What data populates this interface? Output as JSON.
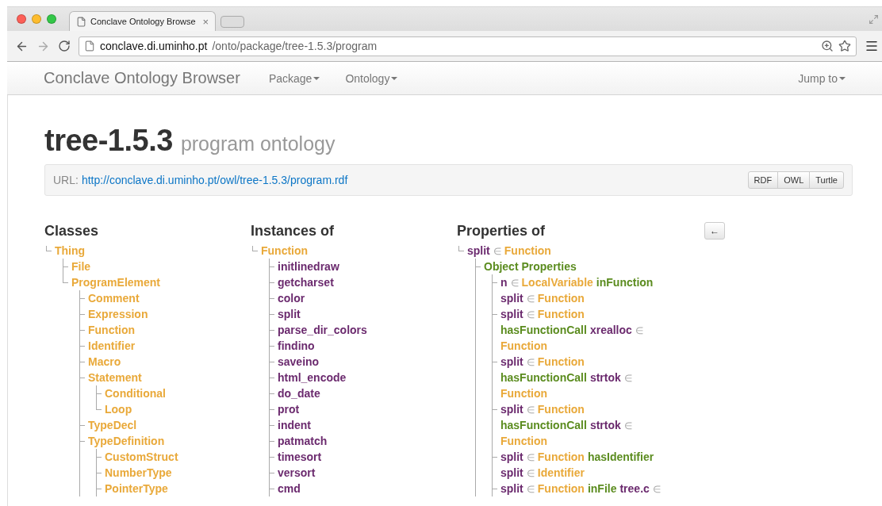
{
  "browser": {
    "tab": {
      "title": "Conclave Ontology Browse",
      "close": "×"
    },
    "address": {
      "host": "conclave.di.uminho.pt",
      "path": "/onto/package/tree-1.5.3/program"
    }
  },
  "navbar": {
    "brand": "Conclave Ontology Browser",
    "menus": [
      {
        "label": "Package"
      },
      {
        "label": "Ontology"
      }
    ],
    "right_menu": {
      "label": "Jump to"
    }
  },
  "header": {
    "title": "tree-1.5.3",
    "subtitle": "program ontology"
  },
  "url_bar": {
    "label": "URL:",
    "link": "http://conclave.di.uminho.pt/owl/tree-1.5.3/program.rdf",
    "formats": [
      "RDF",
      "OWL",
      "Turtle"
    ]
  },
  "columns": [
    {
      "heading": "Classes",
      "tree": [
        {
          "last": true,
          "lines": [
            [
              {
                "kind": "class",
                "text": "Thing"
              }
            ]
          ],
          "children": [
            {
              "last": false,
              "lines": [
                [
                  {
                    "kind": "class",
                    "text": "File"
                  }
                ]
              ]
            },
            {
              "last": true,
              "lines": [
                [
                  {
                    "kind": "class",
                    "text": "ProgramElement"
                  }
                ]
              ],
              "children": [
                {
                  "last": false,
                  "lines": [
                    [
                      {
                        "kind": "class",
                        "text": "Comment"
                      }
                    ]
                  ]
                },
                {
                  "last": false,
                  "lines": [
                    [
                      {
                        "kind": "class",
                        "text": "Expression"
                      }
                    ]
                  ]
                },
                {
                  "last": false,
                  "lines": [
                    [
                      {
                        "kind": "class",
                        "text": "Function"
                      }
                    ]
                  ]
                },
                {
                  "last": false,
                  "lines": [
                    [
                      {
                        "kind": "class",
                        "text": "Identifier"
                      }
                    ]
                  ]
                },
                {
                  "last": false,
                  "lines": [
                    [
                      {
                        "kind": "class",
                        "text": "Macro"
                      }
                    ]
                  ]
                },
                {
                  "last": false,
                  "lines": [
                    [
                      {
                        "kind": "class",
                        "text": "Statement"
                      }
                    ]
                  ],
                  "children": [
                    {
                      "last": false,
                      "lines": [
                        [
                          {
                            "kind": "class",
                            "text": "Conditional"
                          }
                        ]
                      ]
                    },
                    {
                      "last": true,
                      "lines": [
                        [
                          {
                            "kind": "class",
                            "text": "Loop"
                          }
                        ]
                      ]
                    }
                  ]
                },
                {
                  "last": false,
                  "lines": [
                    [
                      {
                        "kind": "class",
                        "text": "TypeDecl"
                      }
                    ]
                  ]
                },
                {
                  "last": false,
                  "lines": [
                    [
                      {
                        "kind": "class",
                        "text": "TypeDefinition"
                      }
                    ]
                  ],
                  "children": [
                    {
                      "last": false,
                      "lines": [
                        [
                          {
                            "kind": "class",
                            "text": "CustomStruct"
                          }
                        ]
                      ]
                    },
                    {
                      "last": false,
                      "lines": [
                        [
                          {
                            "kind": "class",
                            "text": "NumberType"
                          }
                        ]
                      ]
                    },
                    {
                      "last": false,
                      "lines": [
                        [
                          {
                            "kind": "class",
                            "text": "PointerType"
                          }
                        ]
                      ]
                    }
                  ]
                }
              ]
            }
          ]
        }
      ]
    },
    {
      "heading": "Instances of",
      "tree": [
        {
          "last": true,
          "lines": [
            [
              {
                "kind": "class",
                "text": "Function"
              }
            ]
          ],
          "children": [
            {
              "last": false,
              "lines": [
                [
                  {
                    "kind": "instance",
                    "text": "initlinedraw"
                  }
                ]
              ]
            },
            {
              "last": false,
              "lines": [
                [
                  {
                    "kind": "instance",
                    "text": "getcharset"
                  }
                ]
              ]
            },
            {
              "last": false,
              "lines": [
                [
                  {
                    "kind": "instance",
                    "text": "color"
                  }
                ]
              ]
            },
            {
              "last": false,
              "lines": [
                [
                  {
                    "kind": "instance",
                    "text": "split"
                  }
                ]
              ]
            },
            {
              "last": false,
              "lines": [
                [
                  {
                    "kind": "instance",
                    "text": "parse_dir_colors"
                  }
                ]
              ]
            },
            {
              "last": false,
              "lines": [
                [
                  {
                    "kind": "instance",
                    "text": "findino"
                  }
                ]
              ]
            },
            {
              "last": false,
              "lines": [
                [
                  {
                    "kind": "instance",
                    "text": "saveino"
                  }
                ]
              ]
            },
            {
              "last": false,
              "lines": [
                [
                  {
                    "kind": "instance",
                    "text": "html_encode"
                  }
                ]
              ]
            },
            {
              "last": false,
              "lines": [
                [
                  {
                    "kind": "instance",
                    "text": "do_date"
                  }
                ]
              ]
            },
            {
              "last": false,
              "lines": [
                [
                  {
                    "kind": "instance",
                    "text": "prot"
                  }
                ]
              ]
            },
            {
              "last": false,
              "lines": [
                [
                  {
                    "kind": "instance",
                    "text": "indent"
                  }
                ]
              ]
            },
            {
              "last": false,
              "lines": [
                [
                  {
                    "kind": "instance",
                    "text": "patmatch"
                  }
                ]
              ]
            },
            {
              "last": false,
              "lines": [
                [
                  {
                    "kind": "instance",
                    "text": "timesort"
                  }
                ]
              ]
            },
            {
              "last": false,
              "lines": [
                [
                  {
                    "kind": "instance",
                    "text": "versort"
                  }
                ]
              ]
            },
            {
              "last": false,
              "lines": [
                [
                  {
                    "kind": "instance",
                    "text": "cmd"
                  }
                ]
              ]
            }
          ]
        }
      ]
    },
    {
      "heading": "Properties of",
      "back": "←",
      "tree": [
        {
          "last": true,
          "lines": [
            [
              {
                "kind": "instance",
                "text": "split"
              },
              {
                "kind": "member",
                "text": "∈"
              },
              {
                "kind": "class",
                "text": "Function"
              }
            ]
          ],
          "children": [
            {
              "last": false,
              "lines": [
                [
                  {
                    "kind": "property",
                    "text": "Object Properties"
                  }
                ]
              ],
              "children": [
                {
                  "last": false,
                  "lines": [
                    [
                      {
                        "kind": "instance",
                        "text": "n"
                      },
                      {
                        "kind": "member",
                        "text": "∈"
                      },
                      {
                        "kind": "class",
                        "text": "LocalVariable"
                      },
                      {
                        "kind": "property",
                        "text": "inFunction"
                      }
                    ],
                    [
                      {
                        "kind": "instance",
                        "text": "split"
                      },
                      {
                        "kind": "member",
                        "text": "∈"
                      },
                      {
                        "kind": "class",
                        "text": "Function"
                      }
                    ]
                  ]
                },
                {
                  "last": false,
                  "lines": [
                    [
                      {
                        "kind": "instance",
                        "text": "split"
                      },
                      {
                        "kind": "member",
                        "text": "∈"
                      },
                      {
                        "kind": "class",
                        "text": "Function"
                      }
                    ],
                    [
                      {
                        "kind": "property",
                        "text": "hasFunctionCall"
                      },
                      {
                        "kind": "instance",
                        "text": "xrealloc"
                      },
                      {
                        "kind": "member",
                        "text": "∈"
                      }
                    ],
                    [
                      {
                        "kind": "class",
                        "text": "Function"
                      }
                    ]
                  ]
                },
                {
                  "last": false,
                  "lines": [
                    [
                      {
                        "kind": "instance",
                        "text": "split"
                      },
                      {
                        "kind": "member",
                        "text": "∈"
                      },
                      {
                        "kind": "class",
                        "text": "Function"
                      }
                    ],
                    [
                      {
                        "kind": "property",
                        "text": "hasFunctionCall"
                      },
                      {
                        "kind": "instance",
                        "text": "strtok"
                      },
                      {
                        "kind": "member",
                        "text": "∈"
                      }
                    ],
                    [
                      {
                        "kind": "class",
                        "text": "Function"
                      }
                    ]
                  ]
                },
                {
                  "last": false,
                  "lines": [
                    [
                      {
                        "kind": "instance",
                        "text": "split"
                      },
                      {
                        "kind": "member",
                        "text": "∈"
                      },
                      {
                        "kind": "class",
                        "text": "Function"
                      }
                    ],
                    [
                      {
                        "kind": "property",
                        "text": "hasFunctionCall"
                      },
                      {
                        "kind": "instance",
                        "text": "strtok"
                      },
                      {
                        "kind": "member",
                        "text": "∈"
                      }
                    ],
                    [
                      {
                        "kind": "class",
                        "text": "Function"
                      }
                    ]
                  ]
                },
                {
                  "last": false,
                  "lines": [
                    [
                      {
                        "kind": "instance",
                        "text": "split"
                      },
                      {
                        "kind": "member",
                        "text": "∈"
                      },
                      {
                        "kind": "class",
                        "text": "Function"
                      },
                      {
                        "kind": "property",
                        "text": "hasIdentifier"
                      }
                    ],
                    [
                      {
                        "kind": "instance",
                        "text": "split"
                      },
                      {
                        "kind": "member",
                        "text": "∈"
                      },
                      {
                        "kind": "class",
                        "text": "Identifier"
                      }
                    ]
                  ]
                },
                {
                  "last": false,
                  "lines": [
                    [
                      {
                        "kind": "instance",
                        "text": "split"
                      },
                      {
                        "kind": "member",
                        "text": "∈"
                      },
                      {
                        "kind": "class",
                        "text": "Function"
                      },
                      {
                        "kind": "property",
                        "text": "inFile"
                      },
                      {
                        "kind": "instance",
                        "text": "tree.c"
                      },
                      {
                        "kind": "member",
                        "text": "∈"
                      }
                    ]
                  ]
                }
              ]
            }
          ]
        }
      ]
    }
  ]
}
